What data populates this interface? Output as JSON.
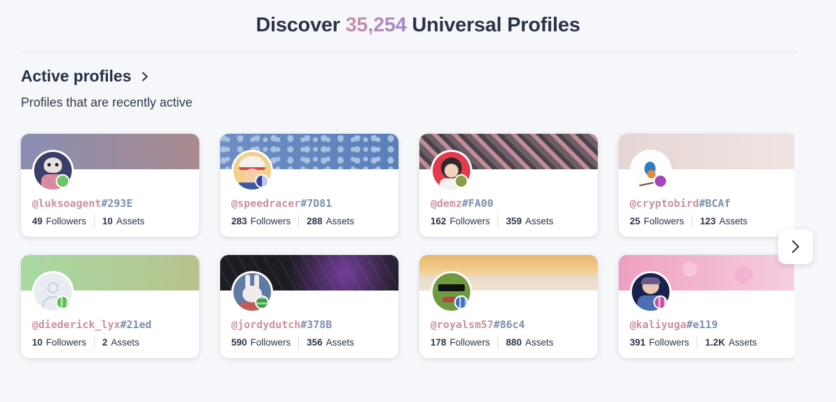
{
  "header": {
    "title_prefix": "Discover",
    "count": "35,254",
    "title_suffix": "Universal Profiles"
  },
  "section": {
    "title": "Active profiles",
    "subtitle": "Profiles that are recently active"
  },
  "profiles": [
    {
      "name": "@luksoagent",
      "hash": "#293E",
      "followers": "49",
      "followers_label": "Followers",
      "assets": "10",
      "assets_label": "Assets"
    },
    {
      "name": "@speedracer",
      "hash": "#7D81",
      "followers": "283",
      "followers_label": "Followers",
      "assets": "288",
      "assets_label": "Assets"
    },
    {
      "name": "@demz",
      "hash": "#FA00",
      "followers": "162",
      "followers_label": "Followers",
      "assets": "359",
      "assets_label": "Assets"
    },
    {
      "name": "@cryptobird",
      "hash": "#BCAf",
      "followers": "25",
      "followers_label": "Followers",
      "assets": "123",
      "assets_label": "Assets"
    },
    {
      "name": "@diederick_lyx",
      "hash": "#21ed",
      "followers": "10",
      "followers_label": "Followers",
      "assets": "2",
      "assets_label": "Assets"
    },
    {
      "name": "@jordydutch",
      "hash": "#378B",
      "followers": "590",
      "followers_label": "Followers",
      "assets": "356",
      "assets_label": "Assets"
    },
    {
      "name": "@royalsm57",
      "hash": "#86c4",
      "followers": "178",
      "followers_label": "Followers",
      "assets": "880",
      "assets_label": "Assets"
    },
    {
      "name": "@kaliyuga",
      "hash": "#e119",
      "followers": "391",
      "followers_label": "Followers",
      "assets": "1.2K",
      "assets_label": "Assets"
    }
  ],
  "icons": {
    "section_chevron": "chevron-right-icon",
    "next_button": "chevron-right-icon"
  },
  "colors": {
    "handle_name": "#c9919f",
    "handle_hash": "#7b8fac",
    "background": "#f6f7fa"
  }
}
